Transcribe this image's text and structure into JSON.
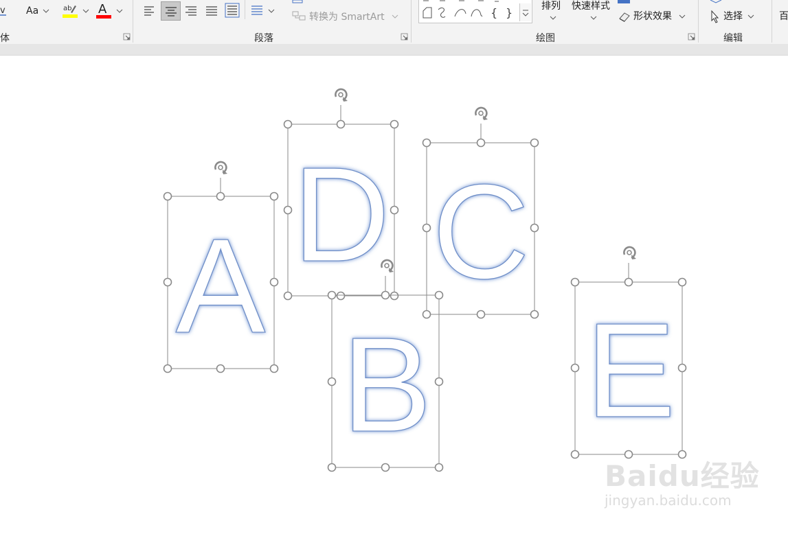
{
  "ribbon": {
    "font_group_label": "体",
    "paragraph_group_label": "段落",
    "drawing_group_label": "绘图",
    "editing_group_label": "编辑",
    "convert_smartart_label": "转换为 SmartArt",
    "arrange_label": "排列",
    "quick_styles_label": "快速样式",
    "shape_effects_label": "形状效果",
    "select_label": "选择",
    "font_case_label": "Aa",
    "highlight_color": "#ffff00",
    "font_color": "#ff0000",
    "accent": "#4472c4",
    "right_edge_char": "百"
  },
  "shapes": [
    {
      "letter": "A",
      "name": "wordart-a"
    },
    {
      "letter": "D",
      "name": "wordart-d"
    },
    {
      "letter": "C",
      "name": "wordart-c"
    },
    {
      "letter": "B",
      "name": "wordart-b"
    },
    {
      "letter": "E",
      "name": "wordart-e"
    }
  ],
  "watermark": {
    "main": "Baidu经验",
    "sub": "jingyan.baidu.com"
  }
}
